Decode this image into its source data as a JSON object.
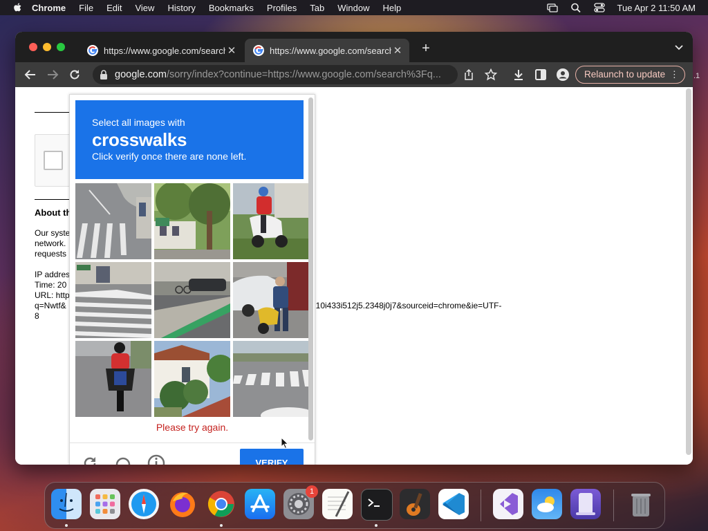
{
  "menubar": {
    "app_name": "Chrome",
    "items": [
      "File",
      "Edit",
      "View",
      "History",
      "Bookmarks",
      "Profiles",
      "Tab",
      "Window",
      "Help"
    ],
    "clock": "Tue Apr 2  11:50 AM"
  },
  "tabs": [
    {
      "title": "https://www.google.com/search",
      "active": false
    },
    {
      "title": "https://www.google.com/search",
      "active": true
    }
  ],
  "toolbar": {
    "url_host": "google.com",
    "url_path": "/sorry/index?continue=https://www.google.com/search%3Fq...",
    "relaunch_label": "Relaunch to update",
    "partial_edge_text": ".1"
  },
  "page": {
    "about_heading": "About th",
    "body_lines": [
      "Our syste",
      "network.",
      "requests"
    ],
    "info_lines": [
      "IP addres",
      "Time: 20",
      "URL: http",
      "q=Nwtf&",
      "8"
    ],
    "url_tail": "i10i433i512j5.2348j0j7&sourceid=chrome&ie=UTF-"
  },
  "captcha": {
    "prompt_line1": "Select all images with",
    "target": "crosswalks",
    "prompt_line3": "Click verify once there are none left.",
    "error": "Please try again.",
    "verify_label": "VERIFY",
    "tiles": [
      "crosswalk-corner",
      "trees-building",
      "scooter-rider",
      "crosswalk-storefront",
      "bike-lane-street",
      "person-scooter-car",
      "motorcycle-rider",
      "house-shrubs",
      "crosswalk-wide"
    ]
  },
  "dock": {
    "apps": [
      "Finder",
      "Launchpad",
      "Safari",
      "Firefox",
      "Chrome",
      "App Store",
      "System Settings",
      "TextEdit",
      "Terminal",
      "GarageBand",
      "Visual Studio Code",
      "Visual Studio",
      "Weather",
      "Simulator",
      "Trash"
    ],
    "settings_badge": "1"
  },
  "colors": {
    "captcha_blue": "#1a73e8",
    "error_red": "#c5221f",
    "relaunch_border": "#e9b2a8"
  }
}
